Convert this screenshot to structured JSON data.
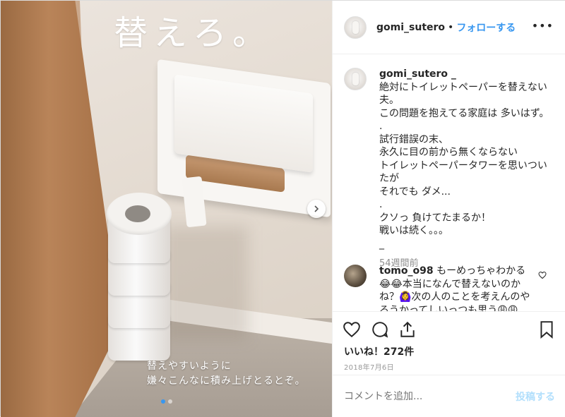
{
  "photo": {
    "overlay_title": "替えろ。",
    "overlay_caption": "替えやすいように\n嫌々こんなに積み上げとるとぞ。",
    "slide_count": 2,
    "active_slide": 1
  },
  "header": {
    "username": "gomi_sutero",
    "separator": "•",
    "follow_label": "フォローする",
    "more_label": "•••"
  },
  "caption": {
    "username": "gomi_sutero _",
    "text": "絶対にトイレットペーパーを替えない夫。\nこの問題を抱えてる家庭は 多いはず。\n.\n試行錯誤の末、\n永久に目の前から無くならない\nトイレットペーパータワーを思いついたが\nそれでも ダメ...\n.\nクソっ 負けてたまるか！\n戦いは続く。。。\n_",
    "time": "54週間前"
  },
  "comments": [
    {
      "username": "tomo_o98",
      "text": "もーめっちゃわかる😂😂本当になんで替えないのかね？🙆‍♀️次の人のことを考えんのやろうかってしいっつも思う😩😩"
    }
  ],
  "actions": {
    "likes_text": "いいね！272件",
    "date": "2018年7月6日"
  },
  "add_comment": {
    "placeholder": "コメントを追加...",
    "post_label": "投稿する"
  },
  "colors": {
    "accent": "#3897f0",
    "post_disabled": "#b2dffc",
    "meta_gray": "#8e8e8e"
  }
}
